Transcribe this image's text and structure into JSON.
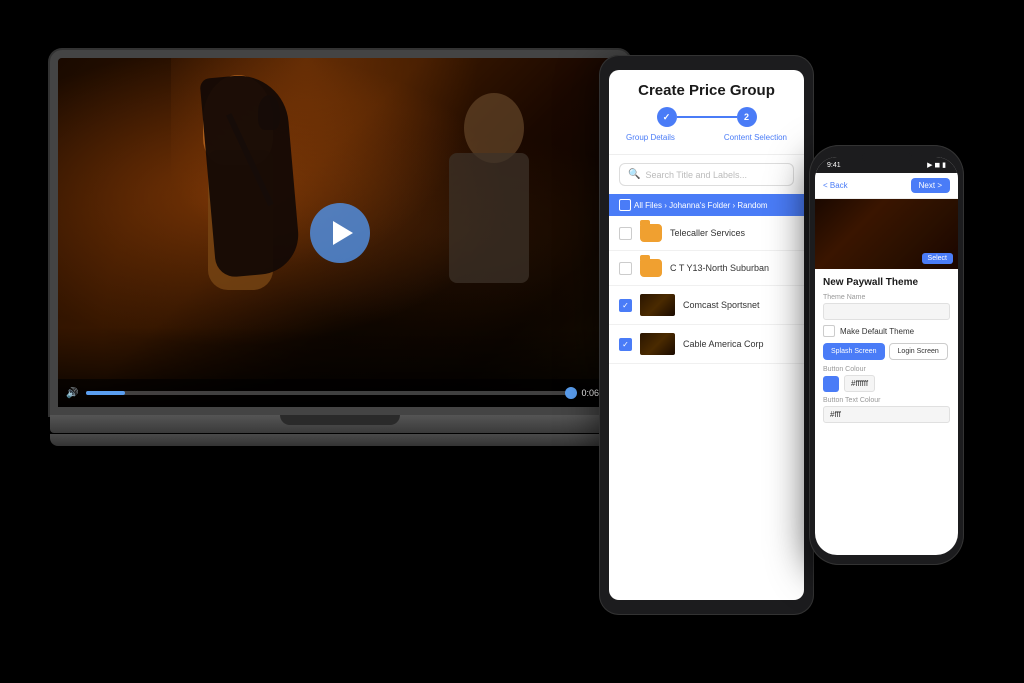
{
  "scene": {
    "bg_color": "#000000"
  },
  "laptop": {
    "video": {
      "play_button_label": "▶",
      "time_current": "0:06",
      "time_total": "0:06",
      "progress_percent": 8
    }
  },
  "tablet": {
    "title": "Create Price Group",
    "steps": [
      {
        "label": "Group Details",
        "state": "completed",
        "number": "1"
      },
      {
        "label": "Content Selection",
        "state": "active",
        "number": "2"
      }
    ],
    "search_placeholder": "Search Title and Labels...",
    "breadcrumb": "All Files › Johanna's Folder › Random",
    "items": [
      {
        "checked": false,
        "type": "folder",
        "name": "Telecaller Services"
      },
      {
        "checked": false,
        "type": "folder",
        "name": "C T Y13-North Suburban"
      },
      {
        "checked": true,
        "type": "video",
        "name": "Comcast Sportsnet"
      },
      {
        "checked": true,
        "type": "video",
        "name": "Cable America Corp"
      }
    ]
  },
  "phone": {
    "status_time": "9:41",
    "status_icons": "●●●",
    "nav_back": "< Back",
    "nav_next": "Next >",
    "section_title": "New Paywall Theme",
    "fields": [
      {
        "label": "Theme Name",
        "value": ""
      },
      {
        "label": "Make Default Theme",
        "type": "checkbox"
      },
      {
        "label": "Button Colour",
        "value": "#ffffff"
      },
      {
        "label": "Button Text Colour",
        "value": "#fff"
      }
    ],
    "buttons": [
      {
        "label": "Splash Screen",
        "type": "primary"
      },
      {
        "label": "Login Screen",
        "type": "secondary"
      }
    ]
  }
}
